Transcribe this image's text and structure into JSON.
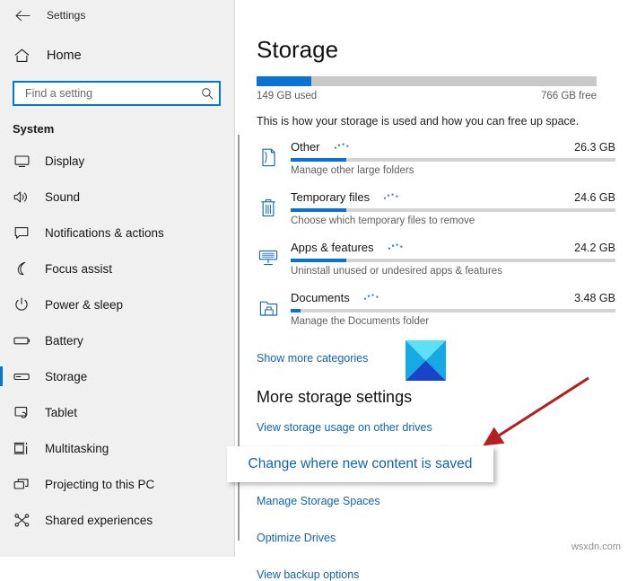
{
  "window": {
    "back_label": "back-arrow",
    "title": "Settings"
  },
  "sidebar": {
    "home_label": "Home",
    "search": {
      "placeholder": "Find a setting",
      "value": "",
      "icon": "search-icon"
    },
    "group_title": "System",
    "items": [
      {
        "label": "Display",
        "icon": "monitor-icon",
        "selected": false
      },
      {
        "label": "Sound",
        "icon": "speaker-icon",
        "selected": false
      },
      {
        "label": "Notifications & actions",
        "icon": "chat-bubble-icon",
        "selected": false
      },
      {
        "label": "Focus assist",
        "icon": "moon-icon",
        "selected": false
      },
      {
        "label": "Power & sleep",
        "icon": "power-icon",
        "selected": false
      },
      {
        "label": "Battery",
        "icon": "battery-icon",
        "selected": false
      },
      {
        "label": "Storage",
        "icon": "drive-icon",
        "selected": true
      },
      {
        "label": "Tablet",
        "icon": "tablet-icon",
        "selected": false
      },
      {
        "label": "Multitasking",
        "icon": "multitasking-icon",
        "selected": false
      },
      {
        "label": "Projecting to this PC",
        "icon": "project-screen-icon",
        "selected": false
      },
      {
        "label": "Shared experiences",
        "icon": "share-icon",
        "selected": false
      }
    ]
  },
  "main": {
    "page_title": "Storage",
    "drive": {
      "used_label": "149 GB used",
      "free_label": "766 GB free",
      "used_percent": 16
    },
    "intro": "This is how your storage is used and how you can free up space.",
    "categories": [
      {
        "name": "Other",
        "size": "26.3 GB",
        "subtitle": "Manage other large folders",
        "icon": "file-page-icon",
        "percent": 17
      },
      {
        "name": "Temporary files",
        "size": "24.6 GB",
        "subtitle": "Choose which temporary files to remove",
        "icon": "trash-bin-icon",
        "percent": 17
      },
      {
        "name": "Apps & features",
        "size": "24.2 GB",
        "subtitle": "Uninstall unused or undesired apps & features",
        "icon": "monitor-keyboard-icon",
        "percent": 17
      },
      {
        "name": "Documents",
        "size": "3.48 GB",
        "subtitle": "Manage the Documents folder",
        "icon": "folder-save-icon",
        "percent": 3
      }
    ],
    "show_more_label": "Show more categories",
    "section_title": "More storage settings",
    "links": [
      "View storage usage on other drives",
      "Change where new content is saved",
      "Manage Storage Spaces",
      "Optimize Drives",
      "View backup options"
    ]
  },
  "callout": {
    "text": "Change where new content is saved"
  },
  "annotation": {
    "arrow_color": "#b51f24",
    "watermark": "wsxdn.com"
  },
  "colors": {
    "accent": "#0078d4",
    "link": "#1063b0",
    "sidebar_bg": "#f0f0f0",
    "tile_top": "#5ddff5",
    "tile_side": "#0fa3e0",
    "tile_bottom": "#1a44c8"
  }
}
